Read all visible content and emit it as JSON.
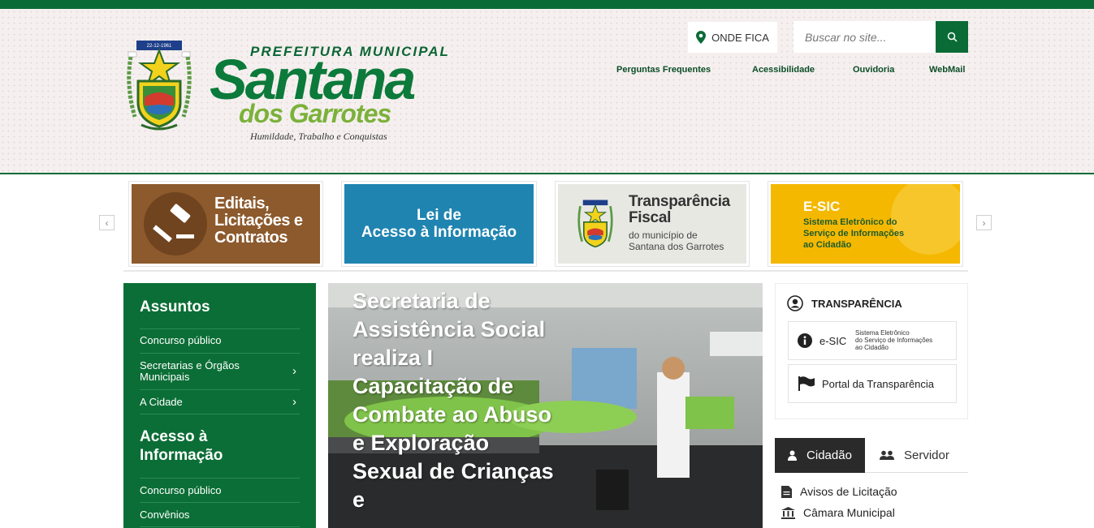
{
  "header": {
    "brand_top": "PREFEITURA MUNICIPAL",
    "brand_name": "Santana",
    "brand_sub": "dos Garrotes",
    "brand_motto": "Humildade, Trabalho e Conquistas",
    "crest_date": "22-12-1961",
    "location_label": "ONDE FICA",
    "search_placeholder": "Buscar no site...",
    "links": [
      "Perguntas Frequentes",
      "Acessibilidade",
      "Ouvidoria",
      "WebMail"
    ]
  },
  "banners": [
    {
      "lines": [
        "Editais,",
        "Licitações e",
        "Contratos"
      ],
      "color": "#8d5a2d"
    },
    {
      "lines": [
        "Lei de",
        "Acesso à Informação"
      ],
      "color": "#1f84b0"
    },
    {
      "title_lines": [
        "Transparência",
        "Fiscal"
      ],
      "sub_lines": [
        "do município de",
        "Santana dos Garrotes"
      ],
      "color": "#e8e8e3"
    },
    {
      "title": "E-SIC",
      "sub_lines": [
        "Sistema Eletrônico do",
        "Serviço de Informações",
        "ao Cidadão"
      ],
      "color": "#f5b800"
    }
  ],
  "sidebar": {
    "heading1": "Assuntos",
    "items1": [
      {
        "label": "Concurso público"
      },
      {
        "label": "Secretarias e Órgãos Municipais"
      },
      {
        "label": "A Cidade"
      }
    ],
    "heading2": "Acesso à Informação",
    "items2": [
      {
        "label": "Concurso público"
      },
      {
        "label": "Convênios"
      }
    ]
  },
  "news": {
    "title": "Secretaria de Assistência Social realiza I Capacitação de Combate ao Abuso e Exploração Sexual de Crianças e"
  },
  "transparencia": {
    "heading": "TRANSPARÊNCIA",
    "esic_label": "e-SIC",
    "esic_desc_lines": [
      "Sistema Eletrônico",
      "do Serviço de Informações",
      "ao Cidadão"
    ],
    "portal_label": "Portal da Transparência"
  },
  "tabs": {
    "active": "Cidadão",
    "inactive": "Servidor",
    "links": [
      "Avisos de Licitação",
      "Câmara Municipal"
    ]
  },
  "colors": {
    "primary_green": "#0a6b36",
    "sidebar_green": "#0b6e36",
    "logo_green": "#0b7a3a",
    "logo_light_green": "#7bb13a"
  }
}
